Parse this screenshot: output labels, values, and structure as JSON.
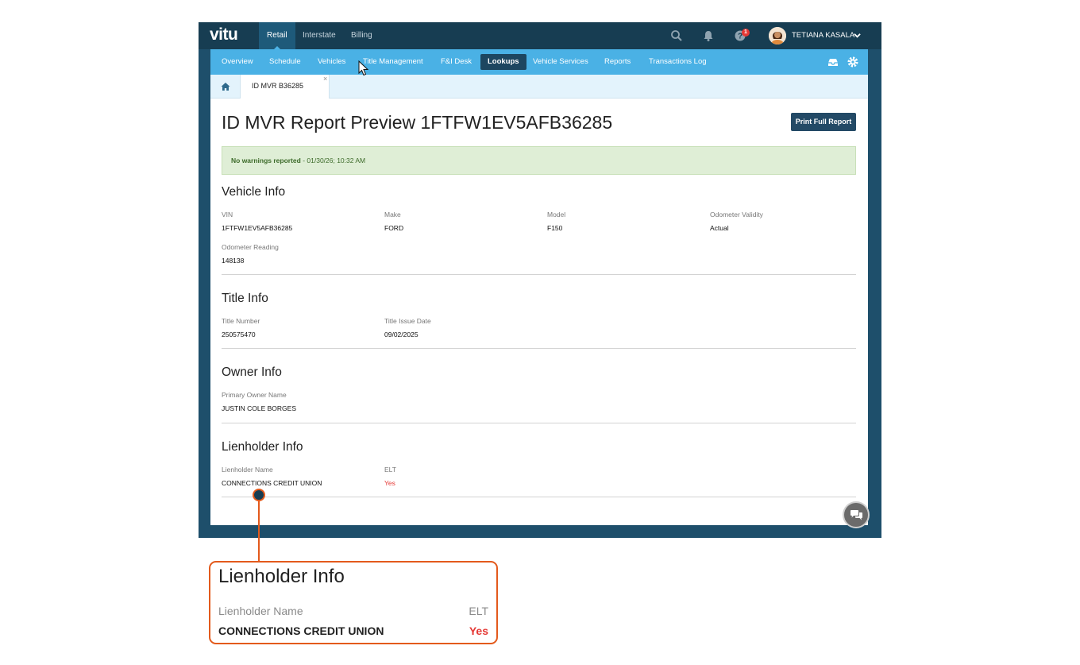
{
  "app": {
    "logo": "vitu",
    "top_tabs": [
      "Retail",
      "Interstate",
      "Billing"
    ],
    "notification_count": "1",
    "user_name": "TETIANA KASALA"
  },
  "subnav": {
    "items": [
      "Overview",
      "Schedule",
      "Vehicles",
      "Title Management",
      "F&I Desk",
      "Lookups",
      "Vehicle Services",
      "Reports",
      "Transactions Log"
    ],
    "active": "Lookups"
  },
  "tabs": {
    "open_tab": "ID MVR B36285",
    "close_glyph": "×"
  },
  "page": {
    "title": "ID MVR Report Preview 1FTFW1EV5AFB36285",
    "print_button": "Print Full Report",
    "alert_strong": "No warnings reported",
    "alert_rest": " - 01/30/26; 10:32 AM"
  },
  "vehicle_info": {
    "title": "Vehicle Info",
    "vin_label": "VIN",
    "vin": "1FTFW1EV5AFB36285",
    "make_label": "Make",
    "make": "FORD",
    "model_label": "Model",
    "model": "F150",
    "odo_validity_label": "Odometer Validity",
    "odo_validity": "Actual",
    "odo_reading_label": "Odometer Reading",
    "odo_reading": "148138"
  },
  "title_info": {
    "title": "Title Info",
    "number_label": "Title Number",
    "number": "250575470",
    "issue_date_label": "Title Issue Date",
    "issue_date": "09/02/2025"
  },
  "owner_info": {
    "title": "Owner Info",
    "primary_label": "Primary Owner Name",
    "primary": "JUSTIN COLE BORGES"
  },
  "lienholder_info": {
    "title": "Lienholder Info",
    "name_label": "Lienholder Name",
    "name": "CONNECTIONS CREDIT UNION",
    "elt_label": "ELT",
    "elt": "Yes"
  },
  "callout": {
    "title": "Lienholder Info",
    "name_label": "Lienholder Name",
    "name": "CONNECTIONS CREDIT UNION",
    "elt_label": "ELT",
    "elt": "Yes"
  },
  "icons": {
    "search": "search-icon",
    "bell": "bell-icon",
    "help": "help-icon",
    "caret": "chevron-down-icon",
    "inbox": "inbox-icon",
    "settings": "gear-icon",
    "home": "home-icon",
    "chat": "chat-icon"
  },
  "colors": {
    "topbar": "#173d52",
    "subnav": "#4ab1e5",
    "active_pill": "#1d4660",
    "print_button": "#234a66",
    "alert_bg": "#dfeed6",
    "alert_text": "#3d6b2a",
    "elt_yes": "#e53935",
    "callout_accent": "#e35a1c"
  }
}
